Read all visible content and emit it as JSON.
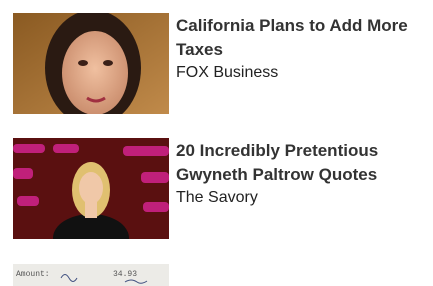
{
  "feed": {
    "items": [
      {
        "headline": "California Plans to Add More Taxes",
        "source": "FOX Business",
        "image": "woman-portrait-photo"
      },
      {
        "headline": "20 Incredibly Pretentious Gwyneth Paltrow Quotes",
        "source": "The Savory",
        "image": "talk-show-guest-photo"
      },
      {
        "headline": "",
        "source": "",
        "image": "handwritten-receipt-photo",
        "image_text": [
          "Amount:",
          "34.93"
        ]
      }
    ]
  }
}
